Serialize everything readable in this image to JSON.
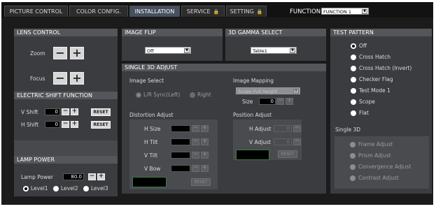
{
  "tabs": [
    {
      "label": "PICTURE CONTROL",
      "active": false,
      "locked": false
    },
    {
      "label": "COLOR CONFIG.",
      "active": false,
      "locked": false
    },
    {
      "label": "INSTALLATION",
      "active": true,
      "locked": false
    },
    {
      "label": "SERVICE",
      "active": false,
      "locked": true
    },
    {
      "label": "SETTING",
      "active": false,
      "locked": true
    }
  ],
  "lock_glyph": "🔒",
  "function": {
    "label": "FUNCTION",
    "value": "FUNCTION 1"
  },
  "arrow_glyph": "▼",
  "lens_control": {
    "title": "LENS CONTROL",
    "zoom_label": "Zoom",
    "focus_label": "Focus",
    "minus": "−",
    "plus": "+"
  },
  "electric_shift": {
    "title": "ELECTRIC SHIFT FUNCTION",
    "v_label": "V Shift",
    "v_value": "0",
    "h_label": "H Shift",
    "h_value": "0",
    "reset": "RESET",
    "minus": "−",
    "plus": "+"
  },
  "lamp_power": {
    "title": "LAMP POWER",
    "label": "Lamp Power",
    "value": "80.0",
    "levels": [
      "Level1",
      "Level2",
      "Level3"
    ],
    "selected_level": "Level1"
  },
  "image_flip": {
    "title": "IMAGE FLIP",
    "value": "Off"
  },
  "gamma": {
    "title": "3D GAMMA SELECT",
    "value": "Table1"
  },
  "single_3d_adjust": {
    "title": "SINGLE 3D ADJUST",
    "image_select": {
      "label": "Image Select",
      "options": [
        "L/R Sync(Left)",
        "Right"
      ],
      "selected": "L/R Sync(Left)"
    },
    "image_mapping": {
      "label": "Image Mapping",
      "value": "Scope Full Height",
      "size_label": "Size",
      "size_value": "0"
    },
    "distortion": {
      "label": "Distortion Adjust",
      "rows": [
        "H Size",
        "H Tilt",
        "V Tilt",
        "V Bow"
      ],
      "reset": "RESET"
    },
    "position": {
      "label": "Position Adjust",
      "h_label": "H Adjust",
      "h_value": "0",
      "v_label": "V Adjust",
      "v_value": "0",
      "reset": "RESET"
    }
  },
  "test_pattern": {
    "title": "TEST PATTERN",
    "options": [
      "Off",
      "Cross Hatch",
      "Cross Hatch (Invert)",
      "Checker Flag",
      "Test Mode 1",
      "Scope",
      "Flat"
    ],
    "selected": "Off",
    "single3d_label": "Single 3D",
    "single3d_options": [
      "Frame Adjust",
      "Prism Adjust",
      "Convergence Adjust",
      "Contrast Adjust"
    ]
  }
}
